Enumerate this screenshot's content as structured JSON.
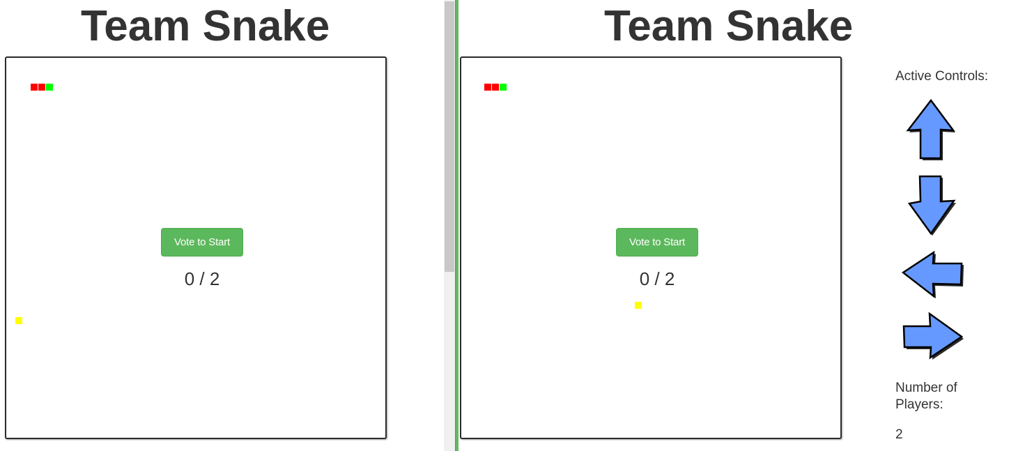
{
  "game": {
    "title": "Team Snake",
    "vote_button_label": "Vote to Start",
    "vote_count": "0 / 2"
  },
  "controls": {
    "label": "Active Controls:",
    "arrows": [
      {
        "direction": "up",
        "icon": "arrow-up-icon"
      },
      {
        "direction": "down",
        "icon": "arrow-down-icon"
      },
      {
        "direction": "left",
        "icon": "arrow-left-icon"
      },
      {
        "direction": "right",
        "icon": "arrow-right-icon"
      }
    ]
  },
  "players": {
    "label": "Number of Players:",
    "count": "2"
  },
  "colors": {
    "snake_body": "#ff0000",
    "snake_head": "#00ff00",
    "food": "#ffff00",
    "button": "#5cb85c",
    "arrow_fill": "#6699ff",
    "divider": "#6ab46a"
  }
}
